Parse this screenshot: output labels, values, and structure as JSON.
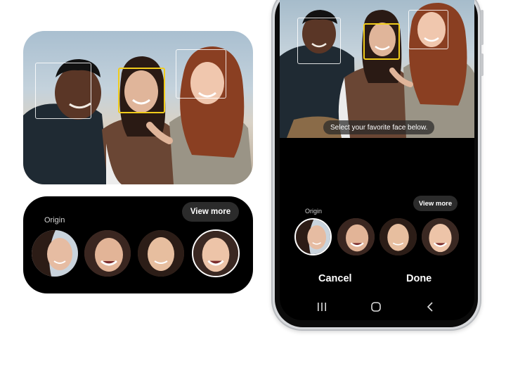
{
  "zoom_panel": {
    "origin_label": "Origin",
    "view_more_label": "View more"
  },
  "phone": {
    "toast_text": "Select your favorite face below.",
    "origin_label": "Origin",
    "view_more_label": "View more",
    "cancel_label": "Cancel",
    "done_label": "Done",
    "nav_icons": [
      "recent-apps-icon",
      "home-icon",
      "back-icon"
    ]
  },
  "colors": {
    "selected_face_box": "#f1cc1c",
    "panel_background": "#000000",
    "pill_background": "#2b2b2b",
    "phone_frame": "#d8dadd"
  }
}
